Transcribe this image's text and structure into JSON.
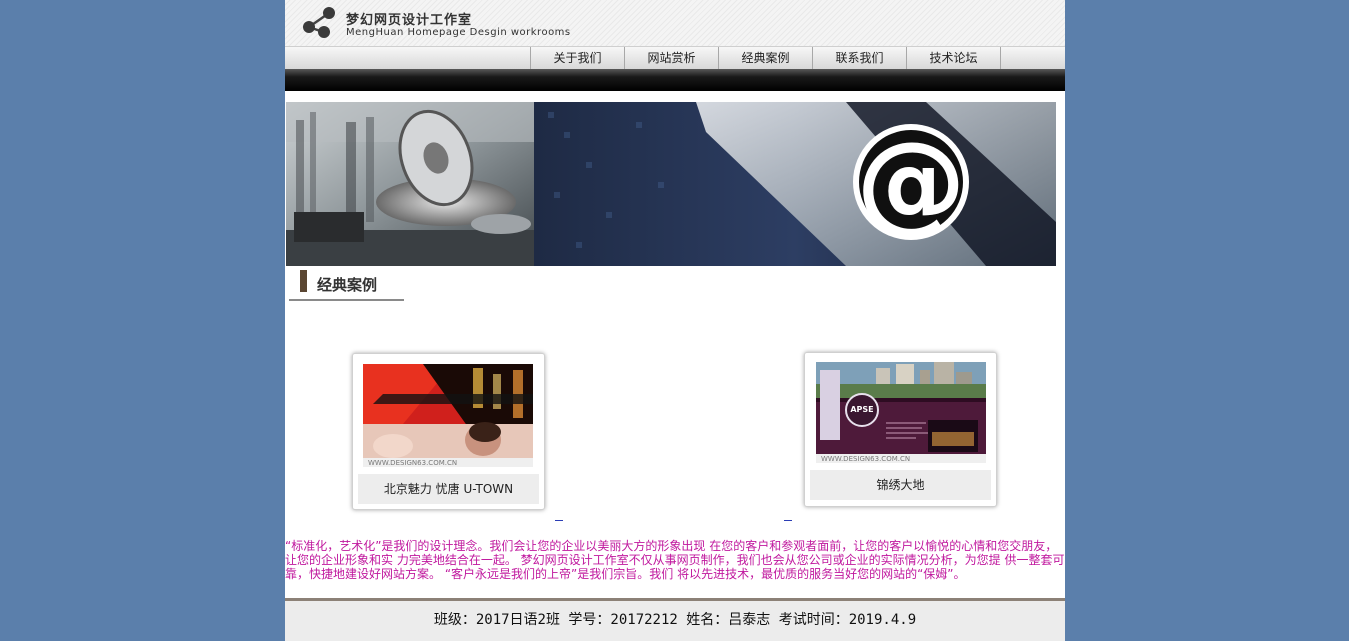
{
  "site": {
    "title_cn": "梦幻网页设计工作室",
    "title_en": "MengHuan Homepage Desgin workrooms",
    "logo_icon": "molecule-dots-icon"
  },
  "nav": {
    "items": [
      {
        "label": "关于我们"
      },
      {
        "label": "网站赏析"
      },
      {
        "label": "经典案例"
      },
      {
        "label": "联系我们"
      },
      {
        "label": "技术论坛"
      }
    ]
  },
  "banner": {
    "symbol": "@"
  },
  "section": {
    "title": "经典案例"
  },
  "cases": [
    {
      "caption": "北京魅力 忧唐 U-TOWN",
      "watermark": "WWW.DESIGN63.COM.CN"
    },
    {
      "caption": "锦绣大地",
      "watermark": "WWW.DESIGN63.COM.CN",
      "logo_text": "APSE"
    }
  ],
  "intro": "“标准化，艺术化”是我们的设计理念。我们会让您的企业以美丽大方的形象出现 在您的客户和参观者面前，让您的客户以愉悦的心情和您交朋友，让您的企业形象和实 力完美地结合在一起。 梦幻网页设计工作室不仅从事网页制作，我们也会从您公司或企业的实际情况分析，为您提 供一整套可靠，快捷地建设好网站方案。 “客户永远是我们的上帝”是我们宗旨。我们 将以先进技术，最优质的服务当好您的网站的“保姆”。",
  "footer": "班级：2017日语2班 学号：20172212 姓名：吕泰志 考试时间：2019.4.9",
  "colors": {
    "page_bg": "#5b7fab",
    "intro_text": "#c0189e",
    "section_marker": "#5a4632"
  }
}
